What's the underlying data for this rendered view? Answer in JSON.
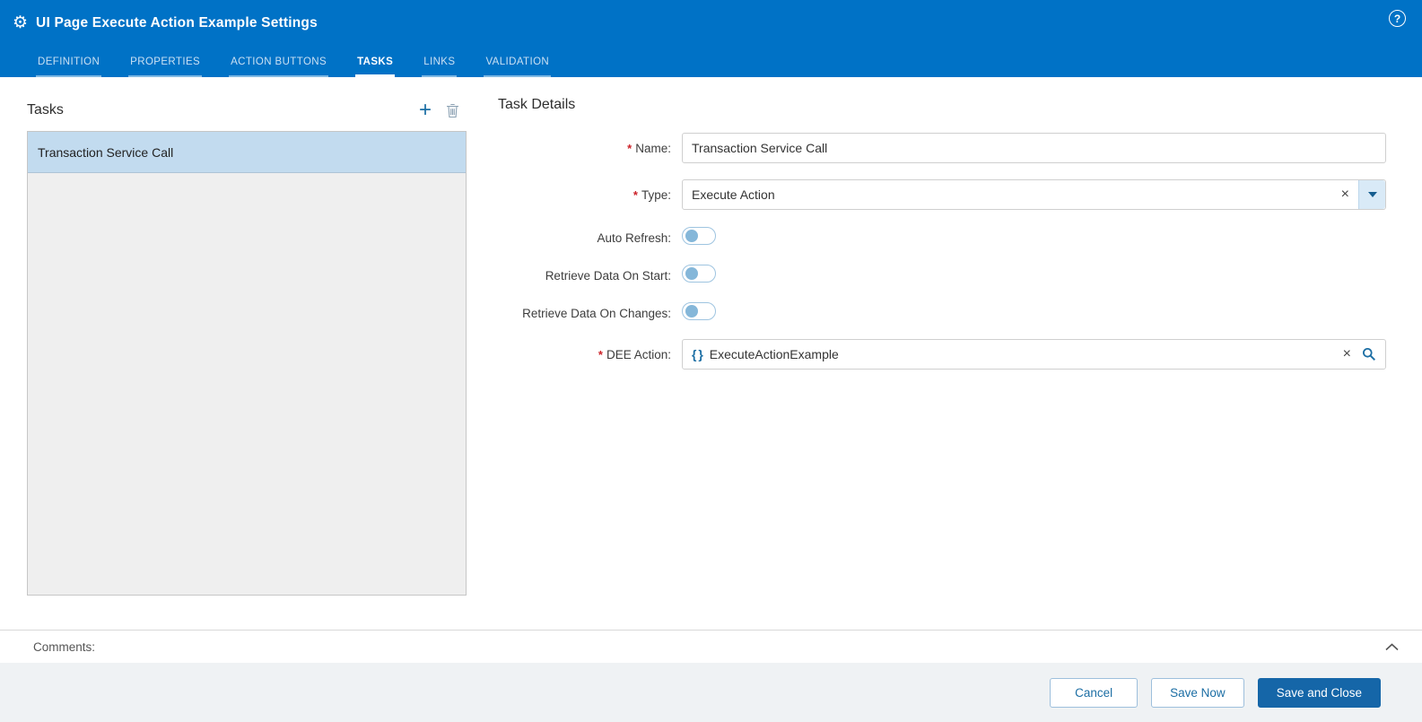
{
  "window": {
    "title": "UI Page Execute Action Example Settings"
  },
  "tabs": [
    {
      "label": "DEFINITION",
      "active": false
    },
    {
      "label": "PROPERTIES",
      "active": false
    },
    {
      "label": "ACTION BUTTONS",
      "active": false
    },
    {
      "label": "TASKS",
      "active": true
    },
    {
      "label": "LINKS",
      "active": false
    },
    {
      "label": "VALIDATION",
      "active": false
    }
  ],
  "tasks_panel": {
    "title": "Tasks",
    "items": [
      {
        "label": "Transaction Service Call",
        "selected": true
      }
    ]
  },
  "task_details": {
    "title": "Task Details",
    "required_marker": "*",
    "name": {
      "label": "Name:",
      "required": true,
      "value": "Transaction Service Call"
    },
    "type": {
      "label": "Type:",
      "required": true,
      "value": "Execute Action"
    },
    "auto_refresh": {
      "label": "Auto Refresh:",
      "state": false
    },
    "retrieve_on_start": {
      "label": "Retrieve Data On Start:",
      "state": false
    },
    "retrieve_on_changes": {
      "label": "Retrieve Data On Changes:",
      "state": false
    },
    "dee_action": {
      "label": "DEE Action:",
      "required": true,
      "value": "ExecuteActionExample"
    }
  },
  "comments": {
    "label": "Comments:"
  },
  "footer": {
    "cancel_label": "Cancel",
    "save_now_label": "Save Now",
    "save_and_close_label": "Save and Close"
  },
  "icons": {
    "gear": "⚙",
    "help": "?",
    "plus": "+",
    "clear": "×",
    "braces": "{ }"
  },
  "colors": {
    "header_blue": "#0072C6",
    "accent_blue": "#1c6ea4",
    "selected_item_bg": "#c2dbef",
    "primary_button_bg": "#1566a8",
    "required_red": "#cc2229"
  }
}
